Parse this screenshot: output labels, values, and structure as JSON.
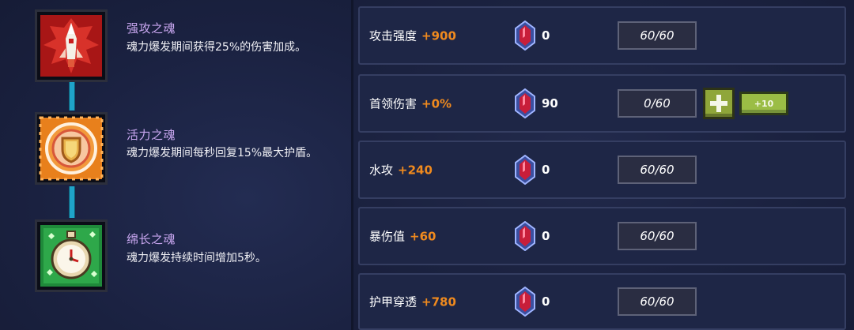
{
  "souls": [
    {
      "name": "强攻之魂",
      "desc": "魂力爆发期间获得25%的伤害加成。",
      "icon": "red-rocket-soul-icon",
      "color": "#c81e1e"
    },
    {
      "name": "活力之魂",
      "desc": "魂力爆发期间每秒回复15%最大护盾。",
      "icon": "orange-shield-soul-icon",
      "color": "#e8801c"
    },
    {
      "name": "绵长之魂",
      "desc": "魂力爆发持续时间增加5秒。",
      "icon": "green-stopwatch-soul-icon",
      "color": "#2ea84a"
    }
  ],
  "stats": [
    {
      "name": "攻击强度",
      "bonus": "+900",
      "gems": "0",
      "level": "60/60"
    },
    {
      "name": "首领伤害",
      "bonus": "+0%",
      "gems": "90",
      "level": "0/60",
      "plus_label": "+",
      "plus10_label": "+10"
    },
    {
      "name": "水攻",
      "bonus": "+240",
      "gems": "0",
      "level": "60/60"
    },
    {
      "name": "暴伤值",
      "bonus": "+60",
      "gems": "0",
      "level": "60/60"
    },
    {
      "name": "护甲穿透",
      "bonus": "+780",
      "gems": "0",
      "level": "60/60"
    }
  ],
  "colors": {
    "bonus": "#f08a1e",
    "soul_name": "#c9a7f0",
    "connector": "#1fa3c9",
    "upgrade_button": "#8fa63a"
  }
}
